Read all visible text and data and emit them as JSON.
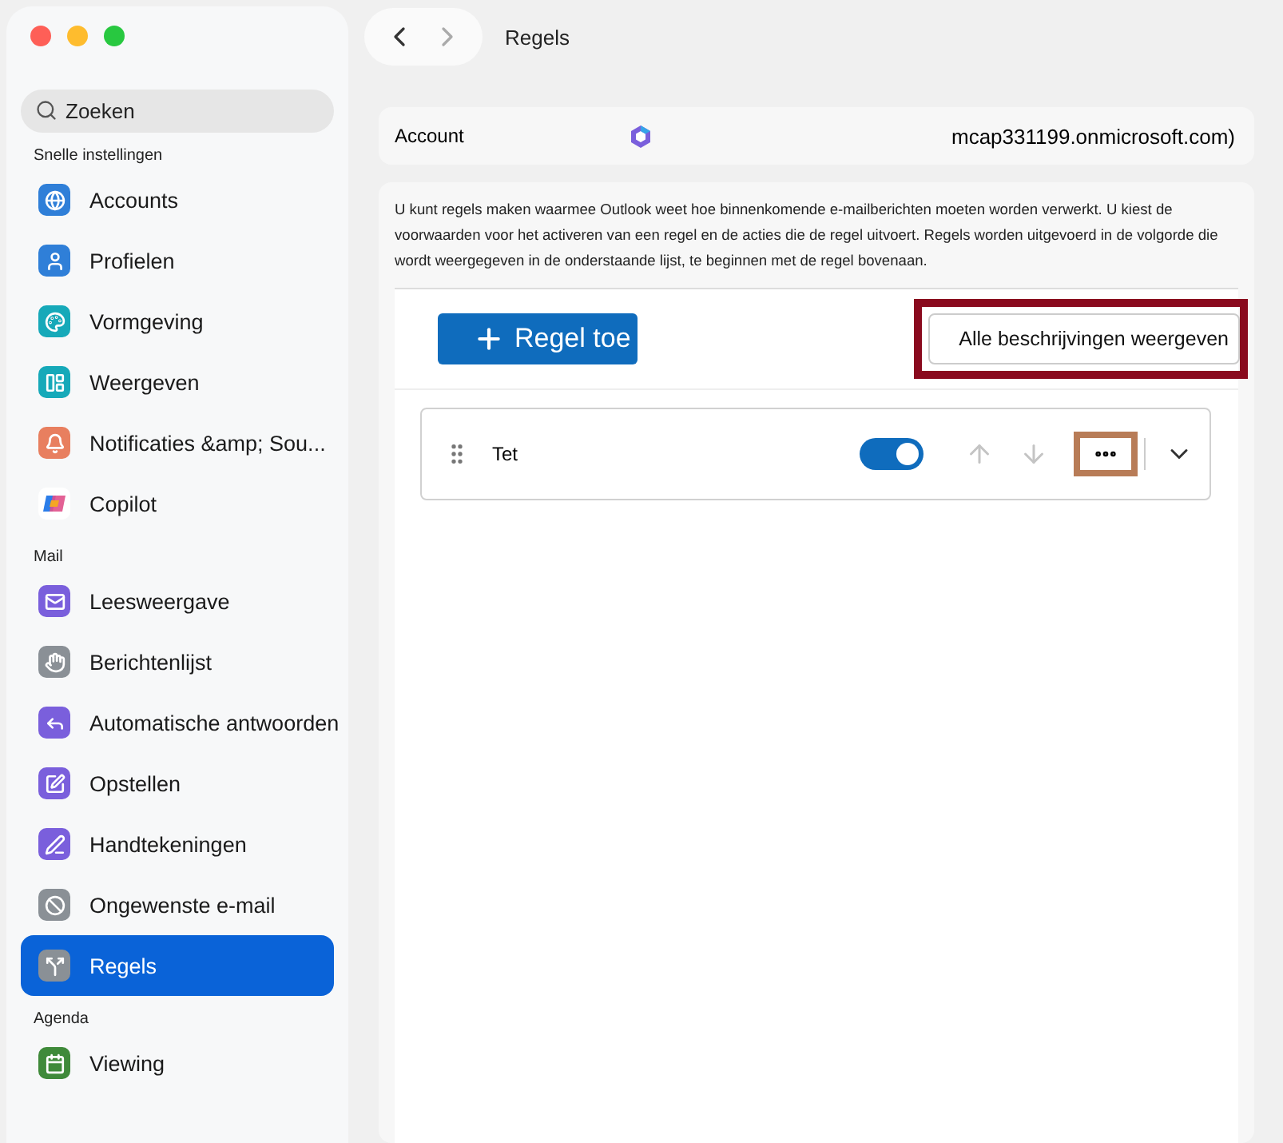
{
  "window": {
    "title": "Regels"
  },
  "search": {
    "placeholder": "Zoeken"
  },
  "sidebar": {
    "sections": [
      {
        "title": "Snelle instellingen",
        "items": [
          {
            "label": "Accounts",
            "color": "#2f7fd8",
            "selected": false
          },
          {
            "label": "Profielen",
            "color": "#2f7fd8",
            "selected": false
          },
          {
            "label": "Vormgeving",
            "color": "#16a9b9",
            "selected": false
          },
          {
            "label": "Weergeven",
            "color": "#16a9b9",
            "selected": false
          },
          {
            "label": "Notificaties &amp; Sou...",
            "color": "#e87f5f",
            "selected": false
          },
          {
            "label": "Copilot",
            "color": "#ffffff",
            "selected": false
          }
        ]
      },
      {
        "title": "Mail",
        "items": [
          {
            "label": "Leesweergave",
            "color": "#7a5fdc",
            "selected": false
          },
          {
            "label": "Berichtenlijst",
            "color": "#8a9096",
            "selected": false
          },
          {
            "label": "Automatische antwoorden",
            "color": "#7a5fdc",
            "selected": false
          },
          {
            "label": "Opstellen",
            "color": "#7a5fdc",
            "selected": false
          },
          {
            "label": "Handtekeningen",
            "color": "#7a5fdc",
            "selected": false
          },
          {
            "label": "Ongewenste e-mail",
            "color": "#8a9096",
            "selected": false
          },
          {
            "label": "Regels",
            "color": "#8a9096",
            "selected": true
          }
        ]
      },
      {
        "title": "Agenda",
        "items": [
          {
            "label": "Viewing",
            "color": "#3f8a3a",
            "selected": false
          }
        ]
      }
    ]
  },
  "account": {
    "label": "Account",
    "value": "mcap331199.onmicrosoft.com)"
  },
  "description": "U kunt regels maken waarmee Outlook weet hoe binnenkomende e-mailberichten moeten worden verwerkt. U kiest de voorwaarden voor het activeren van een regel en de acties die de regel uitvoert. Regels worden uitgevoerd in de volgorde die wordt weergegeven in de onderstaande lijst, te beginnen met de regel bovenaan.",
  "toolbar": {
    "add_button": "Regel toe",
    "show_all_button": "Alle beschrijvingen weergeven",
    "show_all_highlighted": true
  },
  "rules": [
    {
      "name": "Tet",
      "on": true,
      "move_up_disabled": true,
      "move_down_disabled": true,
      "more_highlighted": true,
      "expanded": false
    }
  ]
}
